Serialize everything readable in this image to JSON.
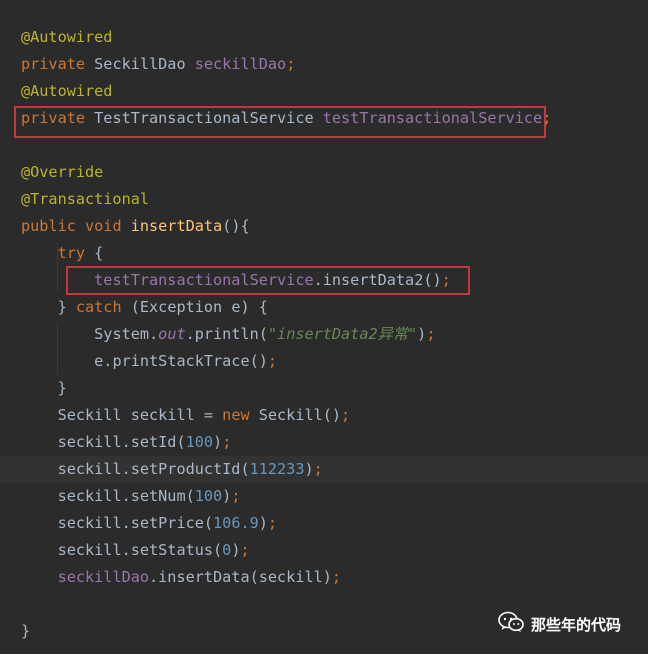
{
  "editor": {
    "current_line": 16,
    "highlight_boxes": [
      3,
      9
    ],
    "lines": [
      [
        [
          "@Autowired",
          "ann"
        ]
      ],
      [
        [
          "private ",
          "kw"
        ],
        [
          "SeckillDao ",
          "txt"
        ],
        [
          "seckillDao",
          "fld"
        ],
        [
          ";",
          "kw"
        ]
      ],
      [
        [
          "@Autowired",
          "ann"
        ]
      ],
      [
        [
          "private ",
          "kw"
        ],
        [
          "TestTransactionalService ",
          "txt"
        ],
        [
          "testTransactionalService",
          "fld"
        ],
        [
          ";",
          "kw"
        ]
      ],
      [],
      [
        [
          "@Override",
          "ann"
        ]
      ],
      [
        [
          "@Transactional",
          "ann"
        ]
      ],
      [
        [
          "public ",
          "kw"
        ],
        [
          "void ",
          "kw"
        ],
        [
          "insertData",
          "fn"
        ],
        [
          "(){",
          "txt"
        ]
      ],
      [
        [
          "    ",
          "txt"
        ],
        [
          "try ",
          "kw"
        ],
        [
          "{",
          "txt"
        ]
      ],
      [
        [
          "        ",
          "txt"
        ],
        [
          "testTransactionalService",
          "fld"
        ],
        [
          ".insertData2()",
          "txt"
        ],
        [
          ";",
          "kw"
        ]
      ],
      [
        [
          "    ",
          "txt"
        ],
        [
          "} ",
          "txt"
        ],
        [
          "catch ",
          "kw"
        ],
        [
          "(Exception e) {",
          "txt"
        ]
      ],
      [
        [
          "        ",
          "txt"
        ],
        [
          "System.",
          "txt"
        ],
        [
          "out",
          "fld-i"
        ],
        [
          ".println(",
          "txt"
        ],
        [
          "\"insertData2异常\"",
          "str-i"
        ],
        [
          ")",
          "txt"
        ],
        [
          ";",
          "kw"
        ]
      ],
      [
        [
          "        ",
          "txt"
        ],
        [
          "e.printStackTrace()",
          "txt"
        ],
        [
          ";",
          "kw"
        ]
      ],
      [
        [
          "    ",
          "txt"
        ],
        [
          "}",
          "txt"
        ]
      ],
      [
        [
          "    ",
          "txt"
        ],
        [
          "Seckill seckill = ",
          "txt"
        ],
        [
          "new ",
          "kw"
        ],
        [
          "Seckill()",
          "txt"
        ],
        [
          ";",
          "kw"
        ]
      ],
      [
        [
          "    ",
          "txt"
        ],
        [
          "seckill.setId(",
          "txt"
        ],
        [
          "100",
          "num"
        ],
        [
          ")",
          "txt"
        ],
        [
          ";",
          "kw"
        ]
      ],
      [
        [
          "    ",
          "txt"
        ],
        [
          "seckill.setProductId(",
          "txt"
        ],
        [
          "112233",
          "num"
        ],
        [
          ")",
          "txt"
        ],
        [
          ";",
          "kw"
        ]
      ],
      [
        [
          "    ",
          "txt"
        ],
        [
          "seckill.setNum(",
          "txt"
        ],
        [
          "100",
          "num"
        ],
        [
          ")",
          "txt"
        ],
        [
          ";",
          "kw"
        ]
      ],
      [
        [
          "    ",
          "txt"
        ],
        [
          "seckill.setPrice(",
          "txt"
        ],
        [
          "106.9",
          "num"
        ],
        [
          ")",
          "txt"
        ],
        [
          ";",
          "kw"
        ]
      ],
      [
        [
          "    ",
          "txt"
        ],
        [
          "seckill.setStatus(",
          "txt"
        ],
        [
          "0",
          "num"
        ],
        [
          ")",
          "txt"
        ],
        [
          ";",
          "kw"
        ]
      ],
      [
        [
          "    ",
          "txt"
        ],
        [
          "seckillDao",
          "fld"
        ],
        [
          ".insertData(seckill)",
          "txt"
        ],
        [
          ";",
          "kw"
        ]
      ],
      [],
      [
        [
          "}",
          "txt"
        ]
      ]
    ]
  },
  "watermark": {
    "icon": "wechat-icon",
    "text": "那些年的代码"
  },
  "colors": {
    "background": "#2b2b2b",
    "annotation": "#bbb529",
    "keyword": "#cc7832",
    "field": "#9876aa",
    "number": "#6897bb",
    "string": "#6a8759",
    "method": "#ffc66d",
    "text": "#a9b7c6",
    "highlight_box": "#c0393b"
  }
}
